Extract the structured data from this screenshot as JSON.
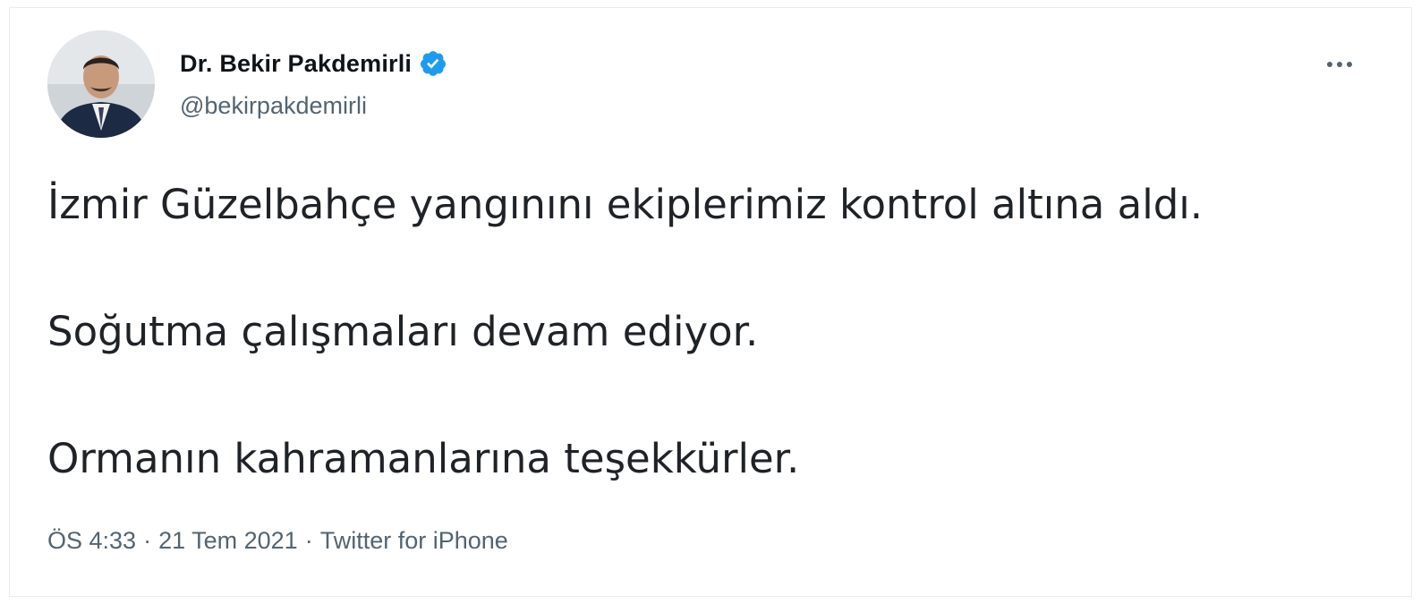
{
  "tweet": {
    "author": {
      "display_name": "Dr. Bekir Pakdemirli",
      "handle": "@bekirpakdemirli",
      "verified": true,
      "avatar_icon": "profile-photo"
    },
    "more_icon": "ellipsis-icon",
    "text_lines": [
      "İzmir Güzelbahçe yangınını ekiplerimiz kontrol altına aldı.",
      "Soğutma çalışmaları devam ediyor.",
      "Ormanın kahramanlarına teşekkürler."
    ],
    "meta": {
      "time": "ÖS 4:33",
      "separator": "·",
      "date": "21 Tem 2021",
      "source": "Twitter for iPhone"
    }
  },
  "colors": {
    "verified_badge": "#1d9bf0",
    "secondary_text": "#536471",
    "primary_text": "#0f1419"
  }
}
